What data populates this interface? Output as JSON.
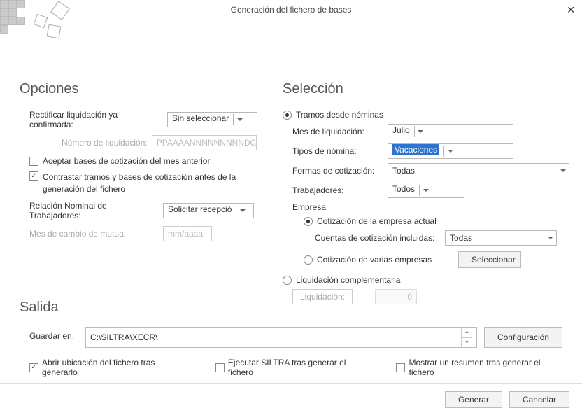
{
  "title": "Generación del fichero de bases",
  "opciones": {
    "heading": "Opciones",
    "rectificar_label": "Rectificar liquidación ya confirmada:",
    "rectificar_value": "Sin seleccionar",
    "num_liq_label": "Número de liquidación:",
    "num_liq_placeholder": "PPAAAANNNNNNNNNDC",
    "aceptar_bases": "Aceptar bases de cotización del mes anterior",
    "contrastar": "Contrastar tramos y bases de cotización antes de la generación del fichero",
    "rnt_label": "Relación Nominal de Trabajadores:",
    "rnt_value": "Solicitar recepció",
    "mutua_label": "Mes de cambio de mutua:",
    "mutua_placeholder": "mm/aaaa"
  },
  "seleccion": {
    "heading": "Selección",
    "tramos_desde": "Tramos desde nóminas",
    "mes_label": "Mes de liquidación:",
    "mes_value": "Julio",
    "tipos_label": "Tipos de nómina:",
    "tipos_value": "Vacaciones",
    "formas_label": "Formas de cotización:",
    "formas_value": "Todas",
    "trab_label": "Trabajadores:",
    "trab_value": "Todos",
    "empresa_label": "Empresa",
    "cot_actual": "Cotización de la empresa actual",
    "cuentas_label": "Cuentas de cotización incluidas:",
    "cuentas_value": "Todas",
    "cot_varias": "Cotización de varias empresas",
    "seleccionar_btn": "Seleccionar",
    "liq_comp": "Liquidación complementaria",
    "liq_label": "Liquidación:",
    "liq_value": "0"
  },
  "salida": {
    "heading": "Salida",
    "guardar_label": "Guardar en:",
    "guardar_value": "C:\\SILTRA\\XECR\\",
    "config_btn": "Configuración",
    "abrir": "Abrir ubicación del fichero tras generarlo",
    "ejecutar": "Ejecutar SILTRA tras generar el fichero",
    "mostrar": "Mostrar un resumen tras generar el fichero"
  },
  "footer": {
    "generar": "Generar",
    "cancelar": "Cancelar"
  }
}
